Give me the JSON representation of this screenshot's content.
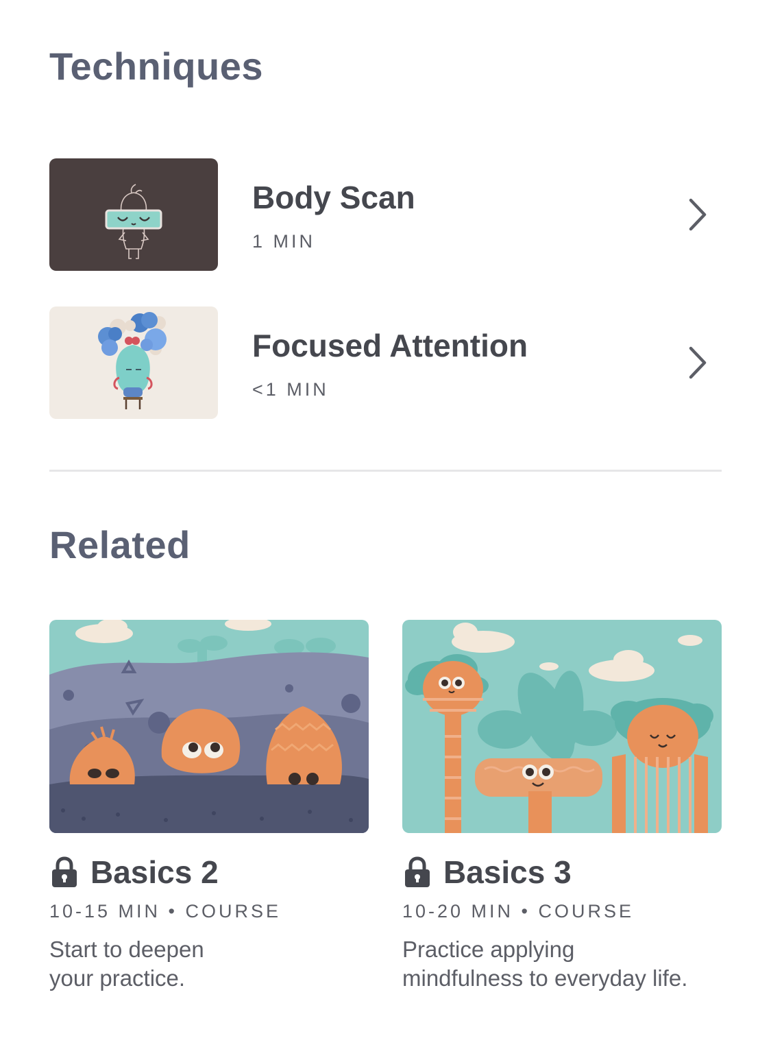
{
  "techniques": {
    "title": "Techniques",
    "items": [
      {
        "title": "Body Scan",
        "meta": "1 MIN"
      },
      {
        "title": "Focused Attention",
        "meta": "<1 MIN"
      }
    ]
  },
  "related": {
    "title": "Related",
    "items": [
      {
        "title": "Basics 2",
        "meta": "10-15 MIN • COURSE",
        "description": "Start to deepen\nyour practice.",
        "locked": true
      },
      {
        "title": "Basics 3",
        "meta": "10-20 MIN • COURSE",
        "description": "Practice applying\nmindfulness to everyday life.",
        "locked": true
      }
    ]
  },
  "colors": {
    "heading": "#5a6073",
    "text_dark": "#45474e",
    "text_meta": "#5c5e66",
    "orange": "#e8915a",
    "teal": "#8ecdc6"
  },
  "icons": {
    "chevron": "chevron-right-icon",
    "lock": "lock-icon"
  }
}
